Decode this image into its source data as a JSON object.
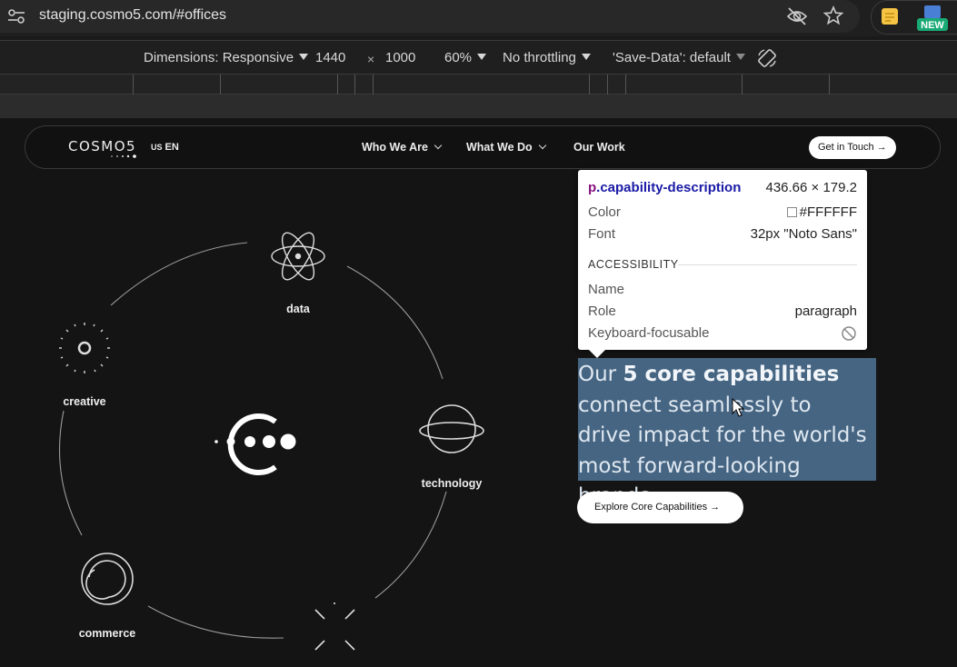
{
  "browser": {
    "url": "staging.cosmo5.com/#offices",
    "ext_badge": "NEW"
  },
  "devtools": {
    "dimensions_label": "Dimensions: Responsive",
    "width": "1440",
    "times": "×",
    "height": "1000",
    "zoom": "60%",
    "throttling": "No throttling",
    "save_data": "'Save-Data': default"
  },
  "site": {
    "logo": "COSMO5",
    "locale_small": "US",
    "locale": "EN",
    "nav": [
      {
        "label": "Who We Are"
      },
      {
        "label": "What We Do"
      },
      {
        "label": "Our Work"
      }
    ],
    "cta": "Get in Touch",
    "capabilities": [
      {
        "label": "data",
        "icon": "atom-icon"
      },
      {
        "label": "creative",
        "icon": "sunburst-icon"
      },
      {
        "label": "technology",
        "icon": "planet-icon"
      },
      {
        "label": "commerce",
        "icon": "swirl-icon"
      }
    ],
    "description_pre": "Our ",
    "description_bold": "5 core capabilities",
    "description_post": " connect seamlessly to drive impact for the world's most forward-looking brands.",
    "explore_label": "Explore Core Capabilities"
  },
  "inspect_tooltip": {
    "tag": "p",
    "class": ".capability-description",
    "size": "436.66 × 179.2",
    "color_label": "Color",
    "color_value": "#FFFFFF",
    "font_label": "Font",
    "font_value": "32px \"Noto Sans\"",
    "accessibility_title": "ACCESSIBILITY",
    "name_label": "Name",
    "role_label": "Role",
    "role_value": "paragraph",
    "focusable_label": "Keyboard-focusable"
  },
  "colors": {
    "page_bg": "#141414",
    "selection": "#6fa8dc",
    "selector_tag": "#881280",
    "selector_class": "#1a1aa6"
  }
}
